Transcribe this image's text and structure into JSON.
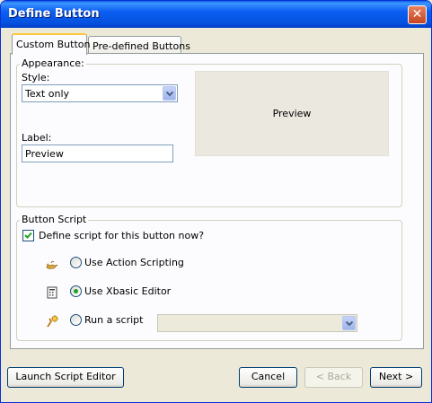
{
  "window": {
    "title": "Define Button"
  },
  "tabs": [
    {
      "label": "Custom Button",
      "active": true
    },
    {
      "label": "Pre-defined Buttons",
      "active": false
    }
  ],
  "appearance": {
    "group_label": "Appearance:",
    "style_label": "Style:",
    "style_value": "Text only",
    "label_label": "Label:",
    "label_value": "Preview",
    "preview_text": "Preview"
  },
  "button_script": {
    "group_label": "Button Script",
    "define_checkbox_label": "Define script for this button now?",
    "define_checked": true,
    "options": [
      {
        "label": "Use Action Scripting",
        "selected": false,
        "icon": "genie-lamp-icon"
      },
      {
        "label": "Use Xbasic Editor",
        "selected": true,
        "icon": "xbasic-editor-icon"
      },
      {
        "label": "Run a script",
        "selected": false,
        "icon": "run-script-icon"
      }
    ],
    "script_select_value": ""
  },
  "footer": {
    "launch_label": "Launch Script Editor",
    "cancel_label": "Cancel",
    "back_label": "< Back",
    "next_label": "Next >"
  },
  "colors": {
    "titlebar": "#0553df",
    "dialog_bg": "#ece9d8",
    "close_button": "#c54422",
    "radio_selected": "#21a121",
    "checkbox_check": "#21a121"
  }
}
